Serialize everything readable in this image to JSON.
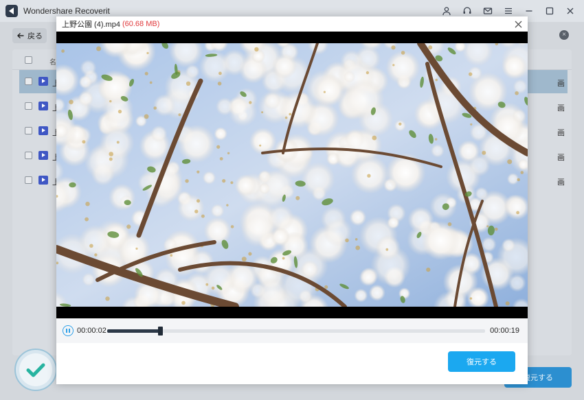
{
  "app": {
    "title": "Wondershare Recoverit",
    "back_label": "戻る",
    "clear_glyph": "×",
    "header_name_partial": "名",
    "rows": [
      {
        "name_partial": "上",
        "tail_partial": "画",
        "selected": true
      },
      {
        "name_partial": "上",
        "tail_partial": "画",
        "selected": false
      },
      {
        "name_partial": "上",
        "tail_partial": "画",
        "selected": false
      },
      {
        "name_partial": "上",
        "tail_partial": "画",
        "selected": false
      },
      {
        "name_partial": "上",
        "tail_partial": "画",
        "selected": false
      }
    ],
    "bg_recover_label": "復元する"
  },
  "modal": {
    "filename": "上野公園 (4).mp4",
    "filesize": "(60.68 MB)",
    "time_current": "00:00:02",
    "time_total": "00:00:19",
    "progress": 0.14,
    "recover_label": "復元する"
  },
  "colors": {
    "accent": "#1ba8f0",
    "filesize": "#e0383b",
    "video_icon": "#3f57c4"
  }
}
